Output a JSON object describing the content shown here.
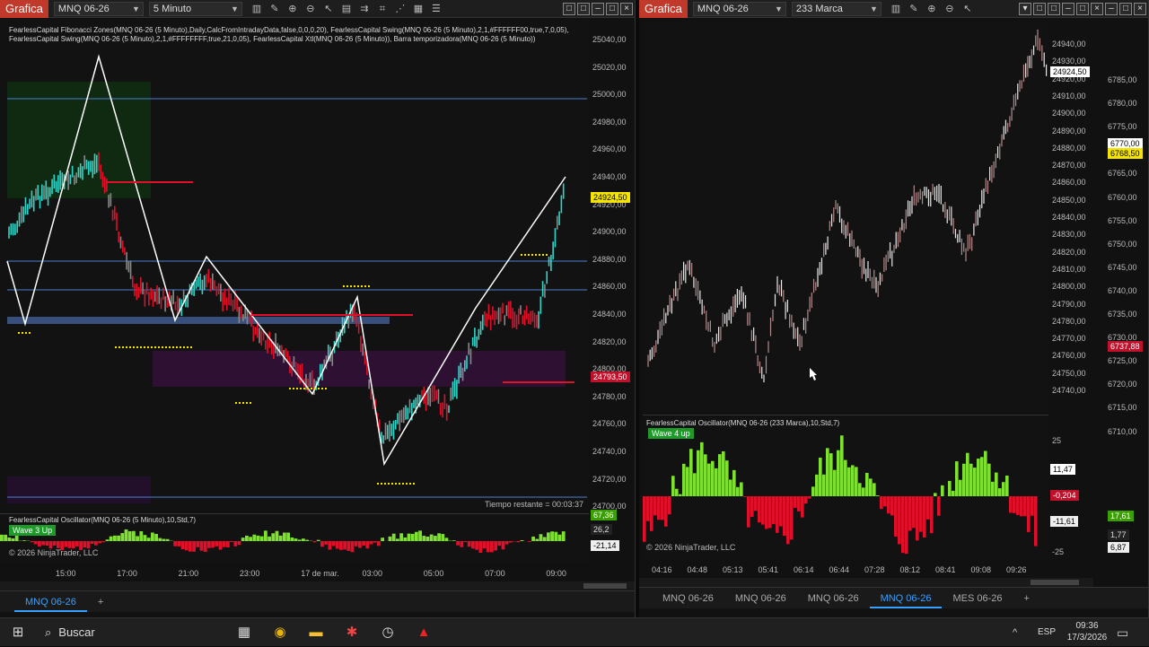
{
  "left": {
    "app_badge": "Grafica",
    "instrument": "MNQ 06-26",
    "interval": "5 Minuto",
    "legend": "FearlessCapital Fibonacci Zones(MNQ 06-26 (5 Minuto),Daily,CalcFromIntradayData,false,0,0,0,20), FearlessCapital Swing(MNQ 06-26 (5 Minuto),2,1,#FFFFFF00,true,7,0,05), FearlessCapital Swing(MNQ 06-26 (5 Minuto),2,1,#FFFFFFFF,true,21,0,05), FearlessCapital Xtl(MNQ 06-26 (5 Minuto)), Barra temporizadora(MNQ 06-26 (5 Minuto))",
    "price_ticks": [
      "25040,00",
      "25020,00",
      "25000,00",
      "24980,00",
      "24960,00",
      "24940,00",
      "24920,00",
      "24900,00",
      "24880,00",
      "24860,00",
      "24840,00",
      "24820,00",
      "24800,00",
      "24780,00",
      "24760,00",
      "24740,00",
      "24720,00",
      "24700,00"
    ],
    "price_tags": {
      "current": "24924,50",
      "low": "24793,50"
    },
    "time_remaining": "Tiempo restante = 00:03:37",
    "oscillator_label": "FearlessCapital Oscillator(MNQ 06-26 (5 Minuto),10,Std,7)",
    "wave_badge": "Wave 3 Up",
    "osc_values": [
      "67,36",
      "26,2",
      "-21,14"
    ],
    "copyright": "© 2026 NinjaTrader, LLC",
    "time_ticks": [
      "15:00",
      "17:00",
      "21:00",
      "23:00",
      "17 de mar.",
      "03:00",
      "05:00",
      "07:00",
      "09:00"
    ],
    "tab": "MNQ 06-26"
  },
  "right": {
    "app_badge": "Grafica",
    "instrument": "MNQ 06-26",
    "interval": "233 Marca",
    "price_ticks": [
      "24940,00",
      "24930,00",
      "24920,00",
      "24910,00",
      "24900,00",
      "24890,00",
      "24880,00",
      "24870,00",
      "24860,00",
      "24850,00",
      "24840,00",
      "24830,00",
      "24820,00",
      "24810,00",
      "24800,00",
      "24790,00",
      "24780,00",
      "24770,00",
      "24760,00",
      "24750,00",
      "24740,00"
    ],
    "price_tag": "24924,50",
    "far_ticks": [
      "6785,00",
      "6780,00",
      "6775,00",
      "6770,00",
      "6765,00",
      "6760,00",
      "6755,00",
      "6750,00",
      "6745,00",
      "6740,00",
      "6735,00",
      "6730,00",
      "6725,00",
      "6720,00",
      "6715,00",
      "6710,00"
    ],
    "far_tags": [
      "6770,00",
      "6768,50",
      "6737,88"
    ],
    "oscillator_label": "FearlessCapital Oscillator(MNQ 06-26 (233 Marca),10,Std,7)",
    "wave_badge": "Wave 4 up",
    "osc_ticks": [
      "25",
      "0",
      "-25"
    ],
    "osc_values": [
      "11,47",
      "-0,204",
      "-11,61"
    ],
    "far_osc_values": [
      "17,61",
      "1,77",
      "6,87"
    ],
    "copyright": "© 2026 NinjaTrader, LLC",
    "time_ticks": [
      "04:16",
      "04:48",
      "05:13",
      "05:41",
      "06:14",
      "06:44",
      "07:28",
      "08:12",
      "08:41",
      "09:08",
      "09:26"
    ],
    "tabs": [
      "MNQ 06-26",
      "MNQ 06-26",
      "MNQ 06-26",
      "MNQ 06-26",
      "MES 06-26"
    ],
    "active_tab_index": 3
  },
  "taskbar": {
    "search_placeholder": "Buscar",
    "language": "ESP",
    "time": "09:36",
    "date": "17/3/2026"
  },
  "colors": {
    "bull": "#2fd6c8",
    "bear": "#e0102a",
    "green": "#7ee030",
    "accent": "#c0392b"
  }
}
